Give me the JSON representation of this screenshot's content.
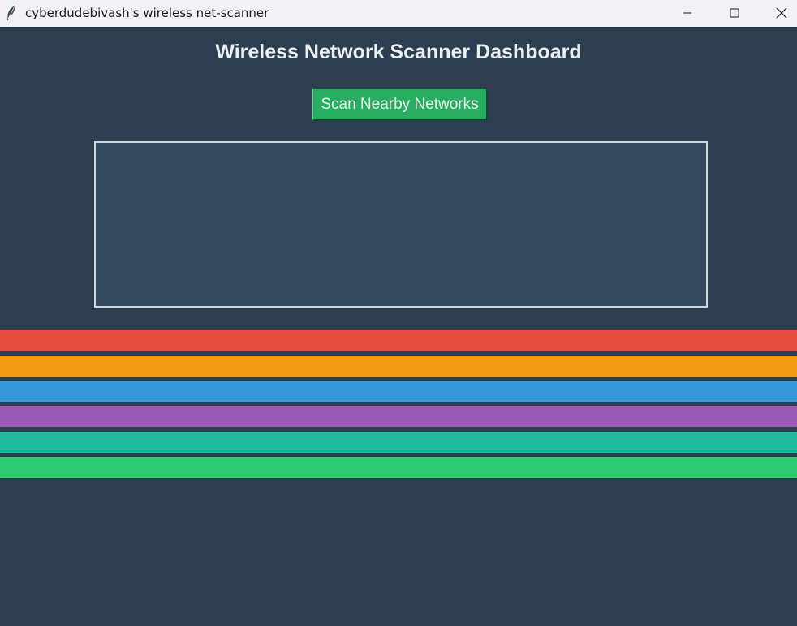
{
  "window": {
    "title": "cyberdudebivash's wireless net-scanner",
    "icon": "feather-icon",
    "controls": [
      "minimize-icon",
      "maximize-icon",
      "close-icon"
    ]
  },
  "main": {
    "heading": "Wireless Network Scanner Dashboard",
    "scan_button_label": "Scan Nearby Networks",
    "results_text": ""
  },
  "colors": {
    "background": "#2c3e50",
    "results_box": "#34495e",
    "button": "#27ae60",
    "heading_text": "#ecf0f1"
  },
  "color_bars": [
    {
      "color": "#e74c3c"
    },
    {
      "color": "#f39c12"
    },
    {
      "color": "#3498db"
    },
    {
      "color": "#9b59b6"
    },
    {
      "color": "#1abc9c"
    },
    {
      "color": "#2ecc71"
    }
  ]
}
